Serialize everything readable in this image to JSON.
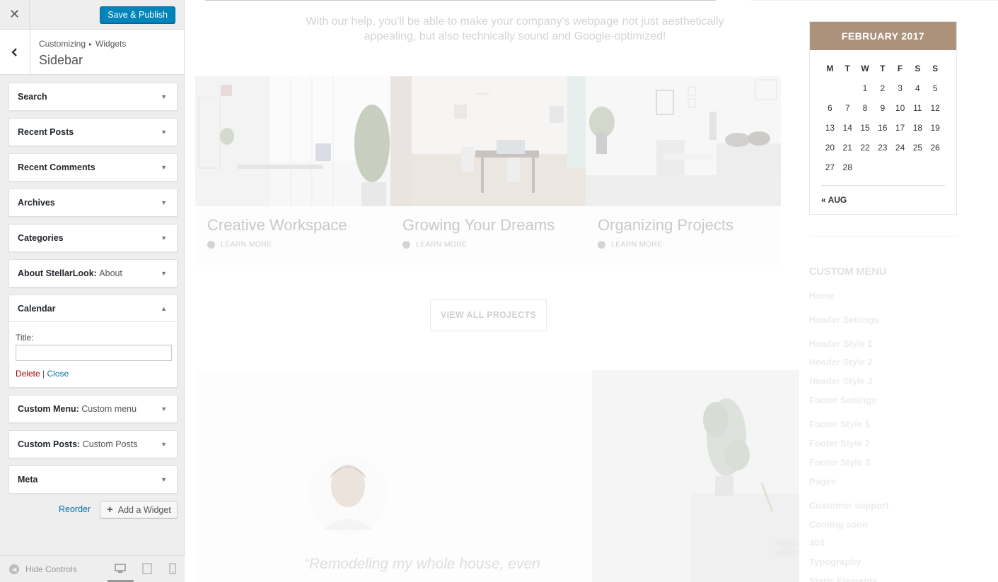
{
  "customizer": {
    "close_glyph": "✕",
    "publish_label": "Save & Publish",
    "breadcrumb": [
      "Customizing",
      "Widgets"
    ],
    "breadcrumb_sep": "▸",
    "section_title": "Sidebar",
    "widgets": [
      {
        "title": "Search",
        "sub": ""
      },
      {
        "title": "Recent Posts",
        "sub": ""
      },
      {
        "title": "Recent Comments",
        "sub": ""
      },
      {
        "title": "Archives",
        "sub": ""
      },
      {
        "title": "Categories",
        "sub": ""
      },
      {
        "title": "About StellarLook",
        "sub": "About"
      },
      {
        "title": "Calendar",
        "sub": ""
      },
      {
        "title": "Custom Menu",
        "sub": "Custom menu"
      },
      {
        "title": "Custom Posts",
        "sub": "Custom Posts"
      },
      {
        "title": "Meta",
        "sub": ""
      }
    ],
    "open_widget": {
      "title_label": "Title:",
      "title_value": "",
      "delete_label": "Delete",
      "separator": "|",
      "close_label": "Close"
    },
    "reorder_label": "Reorder",
    "add_widget_label": "Add a Widget",
    "hide_controls_label": "Hide Controls",
    "accent_color": "#0085ba"
  },
  "preview": {
    "intro_text": "With our help, you'll be able to make your company's webpage not just aesthetically appealing, but also technically sound and Google-optimized!",
    "projects": [
      {
        "title": "Creative Workspace",
        "link": "LEARN MORE"
      },
      {
        "title": "Growing Your Dreams",
        "link": "LEARN MORE"
      },
      {
        "title": "Organizing Projects",
        "link": "LEARN MORE"
      }
    ],
    "view_all_label": "VIEW ALL PROJECTS",
    "quote_text": "“Remodeling my whole house, even",
    "calendar": {
      "header": "FEBRUARY 2017",
      "weekdays": [
        "M",
        "T",
        "W",
        "T",
        "F",
        "S",
        "S"
      ],
      "weeks": [
        [
          "",
          "",
          "1",
          "2",
          "3",
          "4",
          "5"
        ],
        [
          "6",
          "7",
          "8",
          "9",
          "10",
          "11",
          "12"
        ],
        [
          "13",
          "14",
          "15",
          "16",
          "17",
          "18",
          "19"
        ],
        [
          "20",
          "21",
          "22",
          "23",
          "24",
          "25",
          "26"
        ],
        [
          "27",
          "28",
          "",
          "",
          "",
          "",
          ""
        ]
      ],
      "prev_link": "« AUG",
      "header_color": "#ad927b"
    },
    "custom_menu": {
      "title": "CUSTOM MENU",
      "items": [
        "Home",
        "Header Settings",
        "Header Style 1",
        "Header Style 2",
        "Header Style 3",
        "Footer Settings",
        "Footer Style 1",
        "Footer Style 2",
        "Footer Style 3",
        "Pages",
        "Customer support",
        "Coming soon",
        "404",
        "Typography",
        "Static Elements"
      ]
    }
  }
}
